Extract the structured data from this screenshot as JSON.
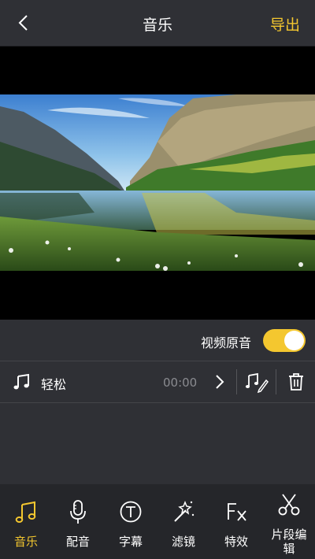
{
  "header": {
    "title": "音乐",
    "export_label": "导出"
  },
  "video": {
    "scene": "mountain lake"
  },
  "settings": {
    "original_audio_label": "视频原音",
    "original_audio_on": true
  },
  "music": {
    "track_name": "轻松",
    "time": "00:00"
  },
  "toolbar": {
    "items": [
      {
        "label": "音乐",
        "icon": "music-note-icon",
        "active": true
      },
      {
        "label": "配音",
        "icon": "microphone-icon",
        "active": false
      },
      {
        "label": "字幕",
        "icon": "text-t-icon",
        "active": false
      },
      {
        "label": "滤镜",
        "icon": "magic-wand-icon",
        "active": false
      },
      {
        "label": "特效",
        "icon": "fx-icon",
        "active": false
      },
      {
        "label": "片段编辑",
        "icon": "scissors-icon",
        "active": false
      }
    ]
  },
  "colors": {
    "accent": "#f4c72f",
    "background": "#2f3035",
    "toolbar": "#25262a",
    "muted": "#8a8b90"
  }
}
